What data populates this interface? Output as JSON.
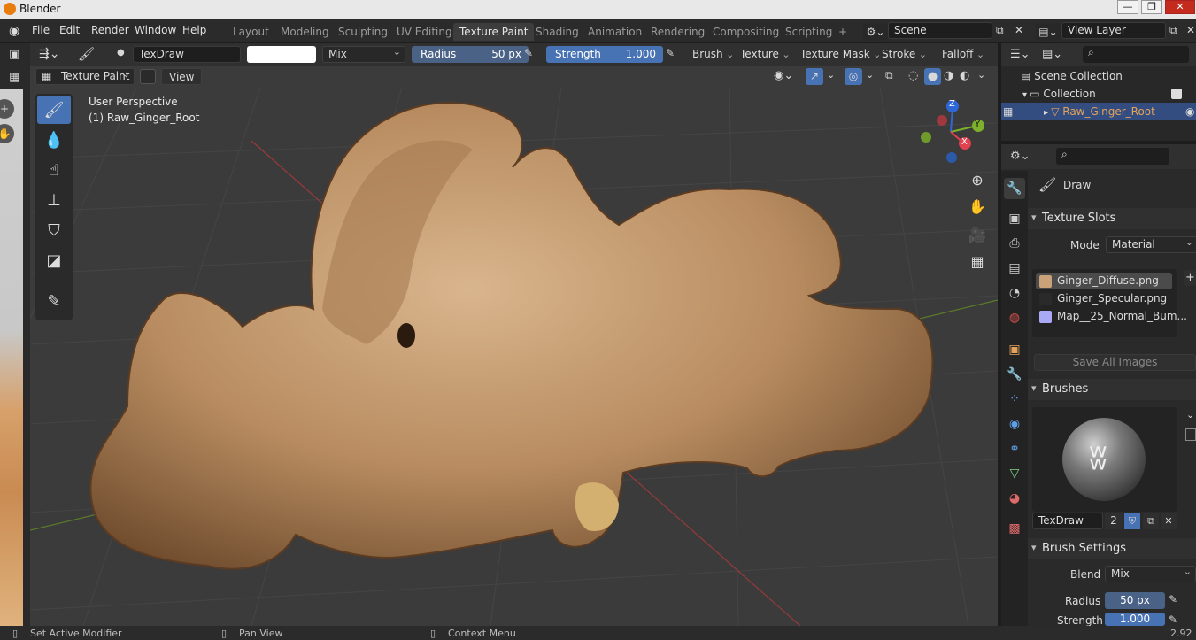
{
  "window": {
    "title": "Blender"
  },
  "menu": [
    "File",
    "Edit",
    "Render",
    "Window",
    "Help"
  ],
  "workspaces": {
    "tabs": [
      "Layout",
      "Modeling",
      "Sculpting",
      "UV Editing",
      "Texture Paint",
      "Shading",
      "Animation",
      "Rendering",
      "Compositing",
      "Scripting"
    ],
    "active": "Texture Paint",
    "add_symbol": "+"
  },
  "scene": {
    "name": "Scene"
  },
  "view_layer": {
    "name": "View Layer"
  },
  "tool_header": {
    "brush_name": "TexDraw",
    "color_hex": "#ffffff",
    "blend": "Mix",
    "radius_label": "Radius",
    "radius_value": "50 px",
    "strength_label": "Strength",
    "strength_value": "1.000",
    "menus": [
      "Brush",
      "Texture",
      "Texture Mask",
      "Stroke",
      "Falloff"
    ]
  },
  "view_header": {
    "mode": "Texture Paint",
    "view_label": "View"
  },
  "viewport": {
    "perspective": "User Perspective",
    "object_label": "(1) Raw_Ginger_Root",
    "gizmo_axes": [
      "Z",
      "Y",
      "X"
    ]
  },
  "outliner": {
    "root": "Scene Collection",
    "collection": "Collection",
    "object": "Raw_Ginger_Root"
  },
  "properties": {
    "tool_name": "Draw",
    "texture_slots": {
      "title": "Texture Slots",
      "mode_label": "Mode",
      "mode_value": "Material",
      "slots": [
        {
          "name": "Ginger_Diffuse.png",
          "color": "#c9a27a"
        },
        {
          "name": "Ginger_Specular.png",
          "color": "#2a2a2a"
        },
        {
          "name": "Map__25_Normal_Bum...",
          "color": "#a9a9f5"
        }
      ],
      "save_label": "Save All Images"
    },
    "brushes": {
      "title": "Brushes",
      "brush_name": "TexDraw",
      "users": "2"
    },
    "brush_settings": {
      "title": "Brush Settings",
      "blend_label": "Blend",
      "blend_value": "Mix",
      "radius_label": "Radius",
      "radius_value": "50 px",
      "strength_label": "Strength",
      "strength_value": "1.000"
    }
  },
  "statusbar": {
    "left": "Set Active Modifier",
    "middle": "Pan View",
    "right": "Context Menu",
    "version": "2.92"
  },
  "colors": {
    "accent": "#4772b3",
    "active_object": "#e3a35b",
    "axis_x": "#e2424f",
    "axis_y": "#7fb02b",
    "axis_z": "#2e68d8"
  }
}
